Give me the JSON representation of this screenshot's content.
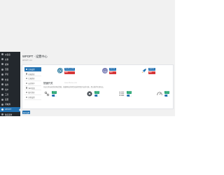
{
  "sidebar": {
    "items": [
      {
        "label": "仪表盘"
      },
      {
        "label": "文章"
      },
      {
        "label": "媒体"
      },
      {
        "label": "页面"
      },
      {
        "label": "评论"
      },
      {
        "label": "外观"
      },
      {
        "label": "插件"
      },
      {
        "label": "用户"
      },
      {
        "label": "工具"
      },
      {
        "label": "设置"
      },
      {
        "label": "闪电博"
      },
      {
        "label": "WPOPT",
        "active": true
      },
      {
        "label": "收起菜单"
      }
    ]
  },
  "header": {
    "title": "WPOPT · 设置中心",
    "subtitle": "WPOPT v1.0"
  },
  "tabs": [
    {
      "label": "全局设置",
      "active": true
    },
    {
      "label": "前端优化"
    },
    {
      "label": "后端优化"
    },
    {
      "label": "安全防护"
    },
    {
      "label": "SEO优化"
    },
    {
      "label": "图片优化"
    },
    {
      "label": "其他设置"
    }
  ],
  "products": [
    {
      "icon": "wordpress-logo-icon",
      "tag1": "WordPress优化",
      "tag2": "推荐"
    },
    {
      "icon": "php-logo-icon",
      "tag1": "PHP优化",
      "tag2": "推荐"
    },
    {
      "icon": "rocket-icon",
      "tag1": "加速优化",
      "tag2": "推荐"
    }
  ],
  "section": {
    "title": "快速开关",
    "watermark": "www.ithome.com",
    "description": "开启后将自动优化网站性能，根据网站实际情况选择需要开启的功能，默认推荐全部开启。"
  },
  "features": [
    {
      "icon": "nodes-icon",
      "tag": "已开启",
      "on": true
    },
    {
      "icon": "block-icon",
      "tag": "已开启",
      "on": true
    },
    {
      "icon": "list-icon",
      "tag": "已开启",
      "on": true
    },
    {
      "icon": "speedometer-icon",
      "tag": "已开启",
      "on": true
    }
  ],
  "save_label": "保存设置",
  "colors": {
    "sidebar_bg": "#23282d",
    "accent": "#2271b1",
    "danger": "#d63638",
    "success": "#1aa06a"
  }
}
